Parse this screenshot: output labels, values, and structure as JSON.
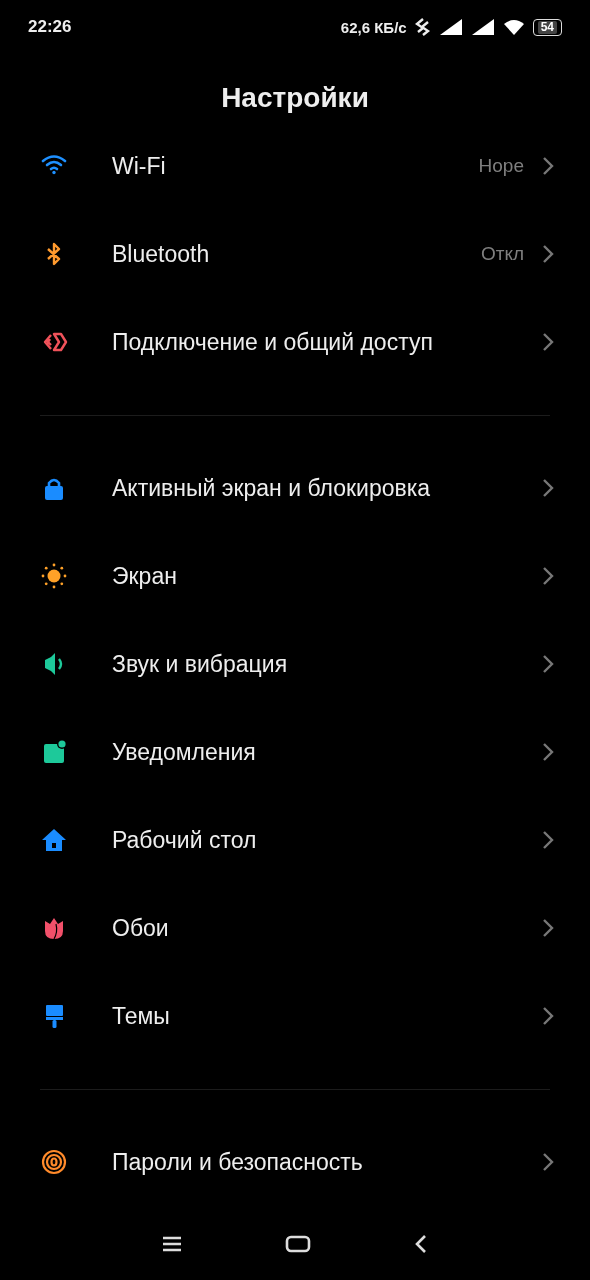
{
  "status_bar": {
    "time": "22:26",
    "net_speed": "62,6 КБ/с",
    "battery": "54"
  },
  "title": "Настройки",
  "groups": [
    {
      "items": [
        {
          "label": "Wi-Fi",
          "value": "Hope"
        },
        {
          "label": "Bluetooth",
          "value": "Откл"
        },
        {
          "label": "Подключение и общий доступ"
        }
      ]
    },
    {
      "items": [
        {
          "label": "Активный экран и блокировка"
        },
        {
          "label": "Экран"
        },
        {
          "label": "Звук и вибрация"
        },
        {
          "label": "Уведомления"
        },
        {
          "label": "Рабочий стол"
        },
        {
          "label": "Обои"
        },
        {
          "label": "Темы"
        }
      ]
    },
    {
      "items": [
        {
          "label": "Пароли и безопасность"
        }
      ]
    }
  ]
}
